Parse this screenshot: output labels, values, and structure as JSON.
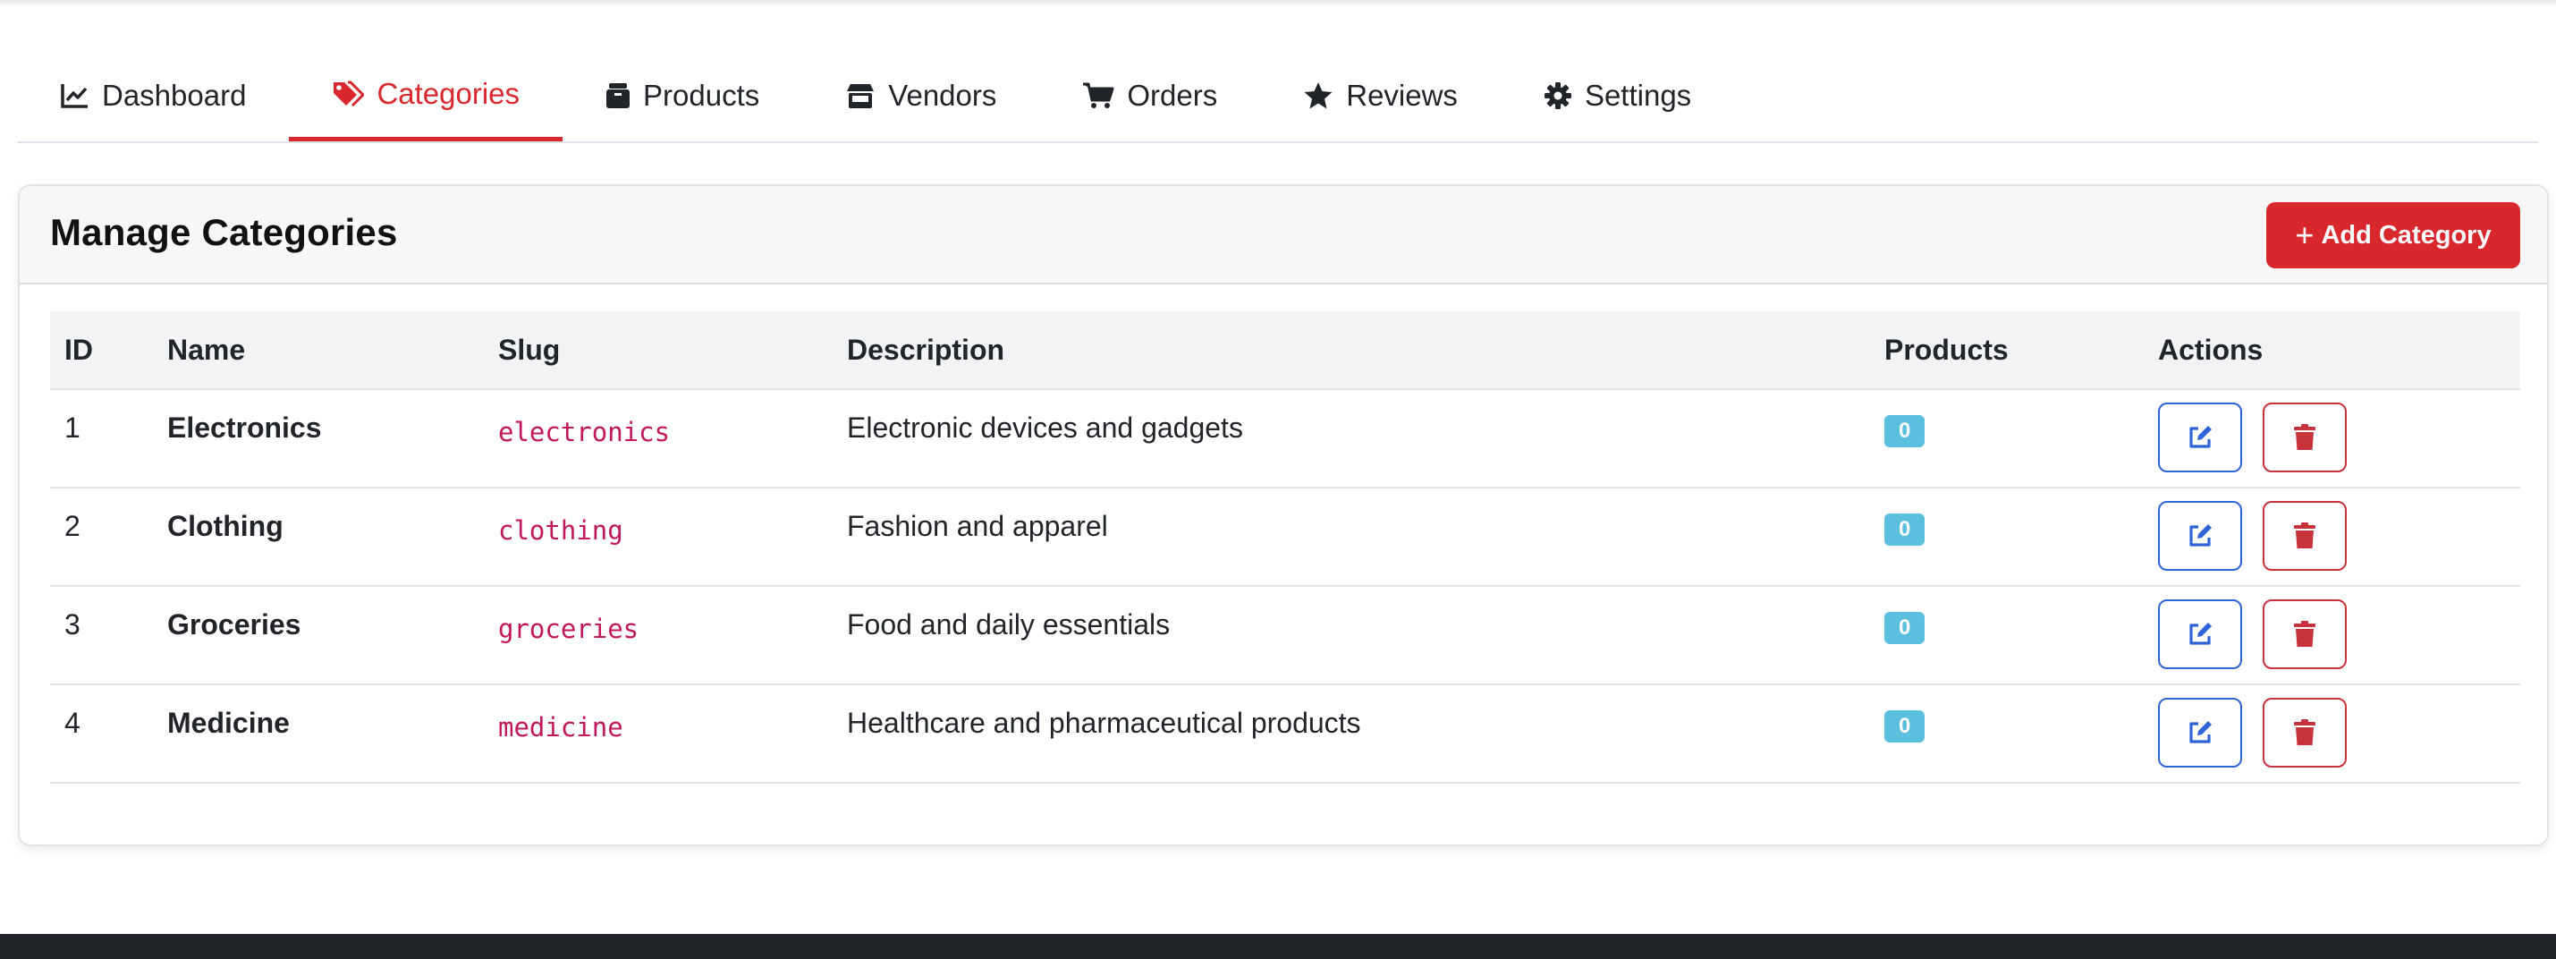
{
  "tabs": [
    {
      "label": "Dashboard",
      "icon": "chart-line-icon",
      "active": false
    },
    {
      "label": "Categories",
      "icon": "tags-icon",
      "active": true
    },
    {
      "label": "Products",
      "icon": "box-icon",
      "active": false
    },
    {
      "label": "Vendors",
      "icon": "store-icon",
      "active": false
    },
    {
      "label": "Orders",
      "icon": "cart-icon",
      "active": false
    },
    {
      "label": "Reviews",
      "icon": "star-icon",
      "active": false
    },
    {
      "label": "Settings",
      "icon": "gear-icon",
      "active": false
    }
  ],
  "card": {
    "title": "Manage Categories",
    "add_button": {
      "plus": "+",
      "label": "Add Category"
    }
  },
  "table": {
    "headers": [
      "ID",
      "Name",
      "Slug",
      "Description",
      "Products",
      "Actions"
    ],
    "rows": [
      {
        "id": "1",
        "name": "Electronics",
        "slug": "electronics",
        "description": "Electronic devices and gadgets",
        "products": "0"
      },
      {
        "id": "2",
        "name": "Clothing",
        "slug": "clothing",
        "description": "Fashion and apparel",
        "products": "0"
      },
      {
        "id": "3",
        "name": "Groceries",
        "slug": "groceries",
        "description": "Food and daily essentials",
        "products": "0"
      },
      {
        "id": "4",
        "name": "Medicine",
        "slug": "medicine",
        "description": "Healthcare and pharmaceutical products",
        "products": "0"
      }
    ]
  },
  "colors": {
    "accent": "#d9272e",
    "badge": "#5bc0de",
    "edit": "#2e64d8",
    "delete": "#c8323a",
    "footer": "#212529"
  }
}
